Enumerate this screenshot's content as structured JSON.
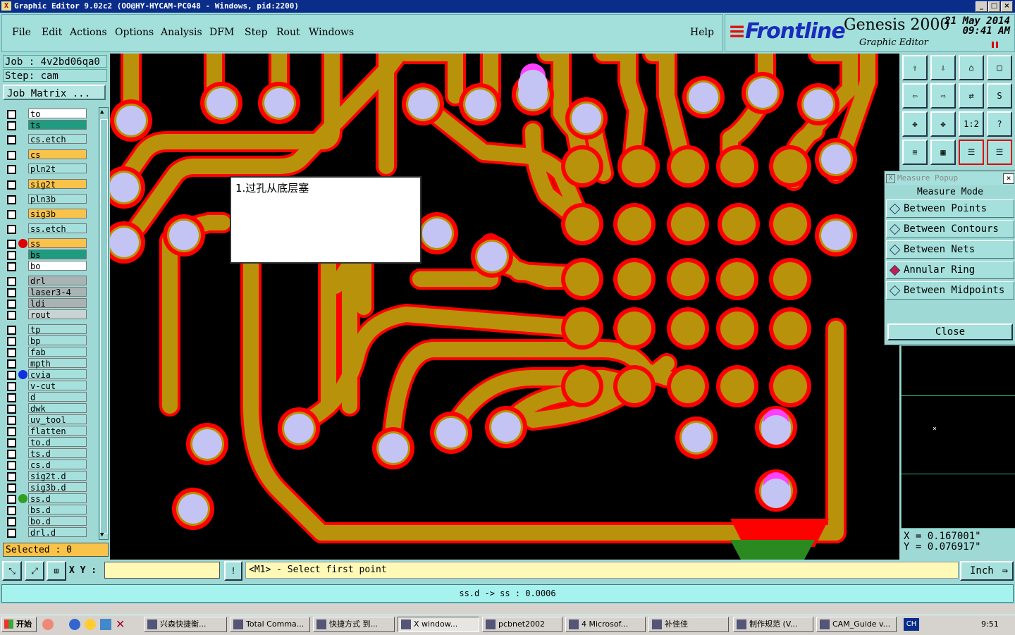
{
  "window": {
    "title": "Graphic Editor 9.02c2  (OO@HY-HYCAM-PC048 - Windows, pid:2200)"
  },
  "menu": [
    "File",
    "Edit",
    "Actions",
    "Options",
    "Analysis",
    "DFM",
    "Step",
    "Rout",
    "Windows"
  ],
  "help_label": "Help",
  "brand": {
    "logo_left": "≡",
    "logo_text": "Frontline",
    "product": "Genesis 2000",
    "subtitle": "Graphic Editor",
    "date": "21 May 2014",
    "time": "09:41 AM"
  },
  "job": {
    "job_label": "Job : 4v2bd06qa0",
    "step_label": "Step: cam",
    "matrix_button": "Job Matrix ..."
  },
  "layers": [
    {
      "name": "to",
      "color": "#ffffff",
      "dot": ""
    },
    {
      "name": "ts",
      "color": "#1f9c80",
      "dot": ""
    },
    {
      "name": "cs.etch",
      "color": "#a6e0dc",
      "dot": ""
    },
    {
      "name": "cs",
      "color": "#f9c34a",
      "dot": ""
    },
    {
      "name": "pln2t",
      "color": "#a6e0dc",
      "dot": ""
    },
    {
      "name": "sig2t",
      "color": "#f9c34a",
      "dot": ""
    },
    {
      "name": "pln3b",
      "color": "#a6e0dc",
      "dot": ""
    },
    {
      "name": "sig3b",
      "color": "#f9c34a",
      "dot": ""
    },
    {
      "name": "ss.etch",
      "color": "#a6e0dc",
      "dot": ""
    },
    {
      "name": "ss",
      "color": "#f9c34a",
      "dot": "#e00000"
    },
    {
      "name": "bs",
      "color": "#1f9c80",
      "dot": ""
    },
    {
      "name": "bo",
      "color": "#ffffff",
      "dot": ""
    },
    {
      "name": "drl",
      "color": "#a8b4b4",
      "dot": ""
    },
    {
      "name": "laser3-4",
      "color": "#a8b4b4",
      "dot": ""
    },
    {
      "name": "ldi",
      "color": "#a8b4b4",
      "dot": ""
    },
    {
      "name": "rout",
      "color": "#c8d4d4",
      "dot": ""
    },
    {
      "name": "tp",
      "color": "#a6e0dc",
      "dot": ""
    },
    {
      "name": "bp",
      "color": "#a6e0dc",
      "dot": ""
    },
    {
      "name": "fab",
      "color": "#a6e0dc",
      "dot": ""
    },
    {
      "name": "mpth",
      "color": "#a6e0dc",
      "dot": ""
    },
    {
      "name": "cvia",
      "color": "#a6e0dc",
      "dot": "#1030e0"
    },
    {
      "name": "v-cut",
      "color": "#a6e0dc",
      "dot": ""
    },
    {
      "name": "d",
      "color": "#a6e0dc",
      "dot": ""
    },
    {
      "name": "dwk",
      "color": "#a6e0dc",
      "dot": ""
    },
    {
      "name": "uv_tool",
      "color": "#a6e0dc",
      "dot": ""
    },
    {
      "name": "flatten",
      "color": "#a6e0dc",
      "dot": ""
    },
    {
      "name": "to.d",
      "color": "#a6e0dc",
      "dot": ""
    },
    {
      "name": "ts.d",
      "color": "#a6e0dc",
      "dot": ""
    },
    {
      "name": "cs.d",
      "color": "#a6e0dc",
      "dot": ""
    },
    {
      "name": "sig2t.d",
      "color": "#a6e0dc",
      "dot": ""
    },
    {
      "name": "sig3b.d",
      "color": "#a6e0dc",
      "dot": ""
    },
    {
      "name": "ss.d",
      "color": "#a6e0dc",
      "dot": "#30a020"
    },
    {
      "name": "bs.d",
      "color": "#a6e0dc",
      "dot": ""
    },
    {
      "name": "bo.d",
      "color": "#a6e0dc",
      "dot": ""
    },
    {
      "name": "drl.d",
      "color": "#a6e0dc",
      "dot": ""
    }
  ],
  "selected_label": "Selected : 0",
  "note_text": "1.过孔从底层塞",
  "measure_popup": {
    "title": "Measure Popup",
    "heading": "Measure Mode",
    "options": [
      "Between Points",
      "Between Contours",
      "Between Nets",
      "Annular Ring",
      "Between Midpoints"
    ],
    "selected_option": "Annular Ring",
    "close_label": "Close"
  },
  "tools": [
    "⇧",
    "⇩",
    "⌂",
    "□",
    "⇦",
    "⇨",
    "⇄",
    "S",
    "✥",
    "✥",
    "1:2",
    "?",
    "≡",
    "▦",
    "☰",
    "☰"
  ],
  "coords": {
    "x": "X  =  0.167001\"",
    "y": "Y  =  0.076917\""
  },
  "bottom": {
    "xy_label": "X Y :",
    "xy_value": "",
    "status": "<M1> - Select first point",
    "unit": "Inch",
    "message": "ss.d -> ss : 0.0006",
    "bang": "!"
  },
  "taskbar": {
    "start": "开始",
    "tasks": [
      "兴森快捷衡...",
      "Total Comma...",
      "快捷方式 到...",
      "X window...",
      "pcbnet2002",
      "4 Microsof...",
      "补佳佳",
      "制作规范 (V...",
      "CAM_Guide v..."
    ],
    "active_index": 3,
    "lang": "CH",
    "clock": "9:51"
  },
  "colors": {
    "copper": "#b8920a",
    "mask": "#ff0000",
    "drill": "#c4c4f4",
    "canvas": "#000000"
  }
}
